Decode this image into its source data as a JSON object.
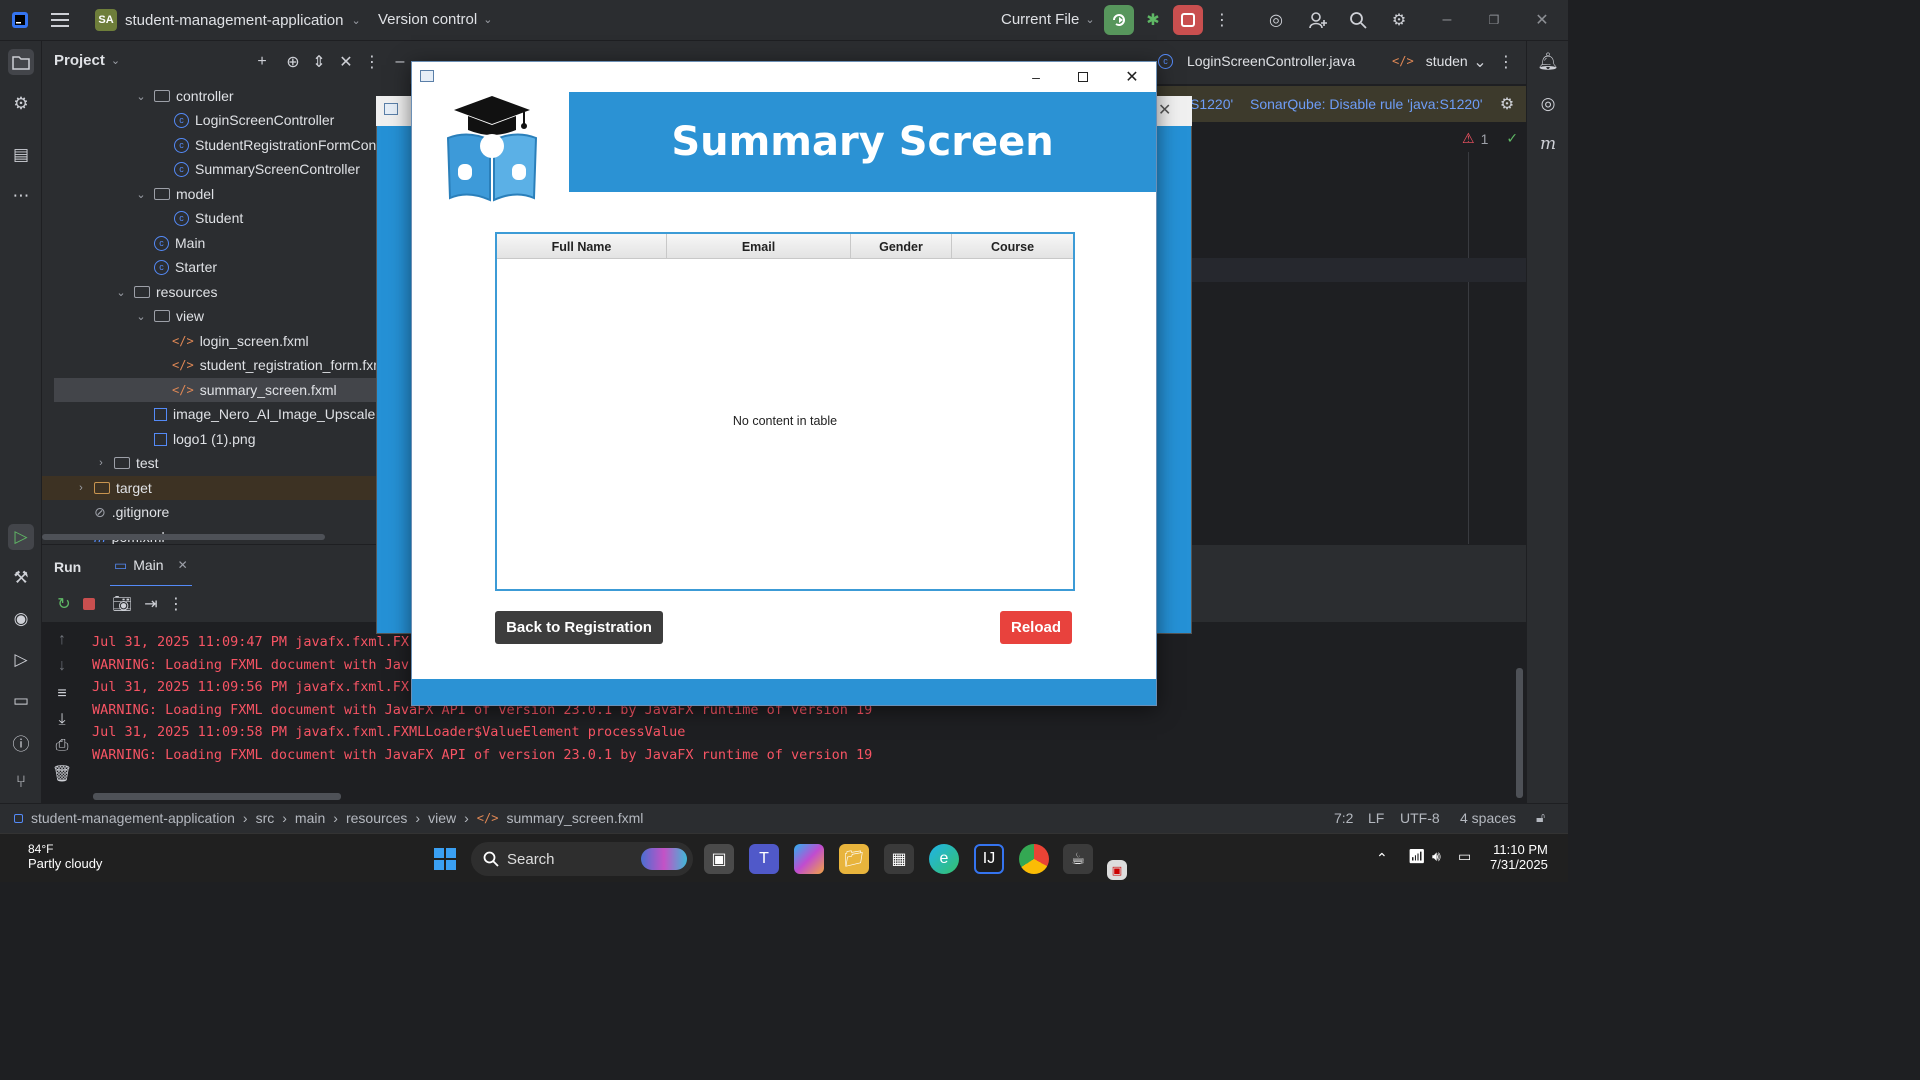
{
  "ide": {
    "project_badge": "SA",
    "project_name": "student-management-application",
    "vcs": "Version control",
    "run_config": "Current File"
  },
  "project_panel": {
    "title": "Project",
    "items": [
      {
        "label": "controller",
        "kind": "folder"
      },
      {
        "label": "LoginScreenController",
        "kind": "class"
      },
      {
        "label": "StudentRegistrationFormCon",
        "kind": "class"
      },
      {
        "label": "SummaryScreenController",
        "kind": "class"
      },
      {
        "label": "model",
        "kind": "folder"
      },
      {
        "label": "Student",
        "kind": "class"
      },
      {
        "label": "Main",
        "kind": "class"
      },
      {
        "label": "Starter",
        "kind": "class"
      },
      {
        "label": "resources",
        "kind": "folder"
      },
      {
        "label": "view",
        "kind": "folder"
      },
      {
        "label": "login_screen.fxml",
        "kind": "xml"
      },
      {
        "label": "student_registration_form.fxm",
        "kind": "xml"
      },
      {
        "label": "summary_screen.fxml",
        "kind": "xml"
      },
      {
        "label": "image_Nero_AI_Image_Upscaler_",
        "kind": "image"
      },
      {
        "label": "logo1 (1).png",
        "kind": "image"
      },
      {
        "label": "test",
        "kind": "folder"
      },
      {
        "label": "target",
        "kind": "folder"
      },
      {
        "label": ".gitignore",
        "kind": "file"
      },
      {
        "label": "pom.xml",
        "kind": "maven"
      }
    ]
  },
  "editor_tabs": [
    {
      "label": "LoginScreenController.java"
    },
    {
      "label": "studen"
    }
  ],
  "banner": {
    "rule_id": "S1220'",
    "action": "SonarQube: Disable rule 'java:S1220'"
  },
  "inspection_count": "1",
  "run_panel": {
    "tab_run": "Run",
    "tab_main": "Main",
    "logs": [
      "Jul 31, 2025 11:09:47 PM javafx.fxml.FX",
      "WARNING: Loading FXML document with Jav",
      "Jul 31, 2025 11:09:56 PM javafx.fxml.FX",
      "WARNING: Loading FXML document with JavaFX API of version 23.0.1 by JavaFX runtime of version 19",
      "Jul 31, 2025 11:09:58 PM javafx.fxml.FXMLLoader$ValueElement processValue",
      "WARNING: Loading FXML document with JavaFX API of version 23.0.1 by JavaFX runtime of version 19"
    ]
  },
  "statusbar": {
    "crumbs": [
      "student-management-application",
      "src",
      "main",
      "resources",
      "view",
      "summary_screen.fxml"
    ],
    "position": "7:2",
    "line_sep": "LF",
    "encoding": "UTF-8",
    "indent": "4 spaces"
  },
  "app_window": {
    "title": "Summary Screen",
    "columns": [
      "Full Name",
      "Email",
      "Gender",
      "Course"
    ],
    "empty_text": "No content in table",
    "back_button": "Back to Registration",
    "reload_button": "Reload",
    "colors": {
      "header": "#2b92d4",
      "reload": "#e8423d",
      "back": "#3d3d3d"
    }
  },
  "taskbar": {
    "weather_temp": "84°F",
    "weather_desc": "Partly cloudy",
    "search": "Search",
    "time": "11:10 PM",
    "date": "7/31/2025"
  }
}
